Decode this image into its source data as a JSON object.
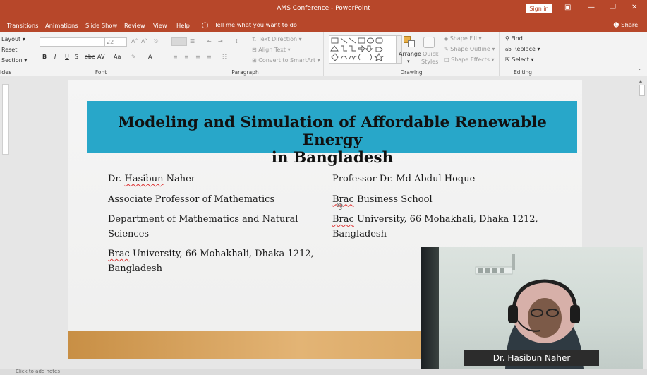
{
  "window": {
    "title": "AMS Conference - PowerPoint",
    "sign_in": "Sign in",
    "share": "Share",
    "tell_me": "Tell me what you want to do"
  },
  "tabs": [
    "Transitions",
    "Animations",
    "Slide Show",
    "Review",
    "View",
    "Help"
  ],
  "ribbon": {
    "slides": {
      "layout": "Layout",
      "reset": "Reset",
      "section": "Section",
      "label": "ides"
    },
    "font": {
      "size": "22",
      "bold": "B",
      "italic": "I",
      "underline": "U",
      "shadow": "S",
      "strike": "abc",
      "spacing": "AV",
      "case": "Aa",
      "font_color": "A",
      "label": "Font"
    },
    "paragraph": {
      "text_direction": "Text Direction",
      "align_text": "Align Text",
      "convert_smartart": "Convert to SmartArt",
      "label": "Paragraph"
    },
    "drawing": {
      "arrange": "Arrange",
      "quick_styles_1": "Quick",
      "quick_styles_2": "Styles",
      "shape_fill": "Shape Fill",
      "shape_outline": "Shape Outline",
      "shape_effects": "Shape Effects",
      "label": "Drawing"
    },
    "editing": {
      "find": "Find",
      "replace": "Replace",
      "select": "Select",
      "label": "Editing"
    }
  },
  "slide": {
    "title_line1": "Modeling and Simulation of Affordable Renewable Energy",
    "title_line2": "in Bangladesh",
    "left": {
      "name_prefix": "Dr. ",
      "name_underlined": "Hasibun",
      "name_suffix": " Naher",
      "position": "Associate Professor of Mathematics",
      "department": "Department of Mathematics and Natural Sciences",
      "uni_underlined": "Brac",
      "uni_rest": " University, 66 Mohakhali, Dhaka 1212, Bangladesh"
    },
    "right": {
      "name": "Professor Dr. Md Abdul Hoque",
      "school_underlined": "Brac",
      "school_rest": " Business School",
      "uni_underlined": "Brac",
      "uni_rest": " University, 66 Mohakhali, Dhaka 1212, Bangladesh"
    }
  },
  "webcam": {
    "name": "Dr. Hasibun Naher"
  },
  "status": {
    "notes": "Click to add notes"
  },
  "colors": {
    "accent": "#b7472a",
    "banner": "#28a7c9"
  }
}
